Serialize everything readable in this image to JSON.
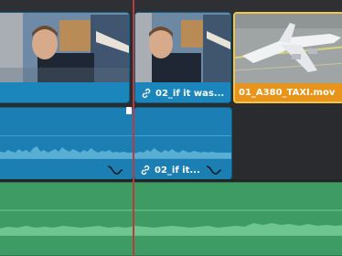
{
  "timeline": {
    "video_clips": [
      {
        "name": "",
        "kind": "interview"
      },
      {
        "name": "02_if it was...",
        "kind": "interview",
        "linked": true
      },
      {
        "name": "01_A380_TAXI.mov",
        "kind": "aircraft",
        "selected": true
      }
    ],
    "audio_clips": [
      {
        "name": ""
      },
      {
        "name": "02_if it...",
        "linked": true
      }
    ],
    "music_clip": {
      "name": ""
    }
  },
  "icons": {
    "link": "link-icon",
    "keyframe_curve": "keyframe-curve-icon"
  },
  "colors": {
    "video_clip": "#1a86bc",
    "selected_clip": "#e8941a",
    "audio_clip": "#1b7fb3",
    "music_clip": "#3f9b64",
    "playhead": "#b93b3b"
  }
}
